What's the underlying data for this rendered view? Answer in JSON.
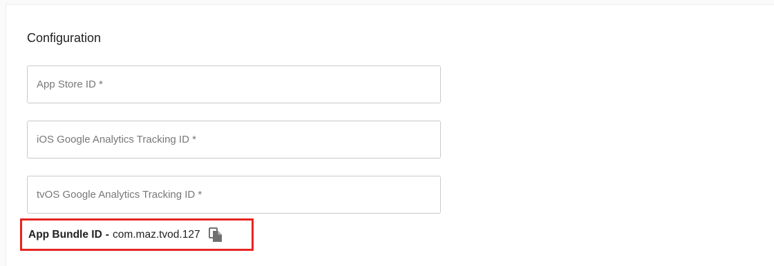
{
  "config": {
    "title": "Configuration",
    "fields": [
      {
        "placeholder": "App Store ID *",
        "value": ""
      },
      {
        "placeholder": "iOS Google Analytics Tracking ID *",
        "value": ""
      },
      {
        "placeholder": "tvOS Google Analytics Tracking ID *",
        "value": ""
      }
    ],
    "bundle": {
      "label": "App Bundle ID",
      "separator": "-",
      "value": "com.maz.tvod.127",
      "copy_icon": "copy-icon"
    }
  },
  "colors": {
    "highlight": "#e52421",
    "border": "#c9c9c9",
    "text": "#212121",
    "icon": "#707070"
  }
}
